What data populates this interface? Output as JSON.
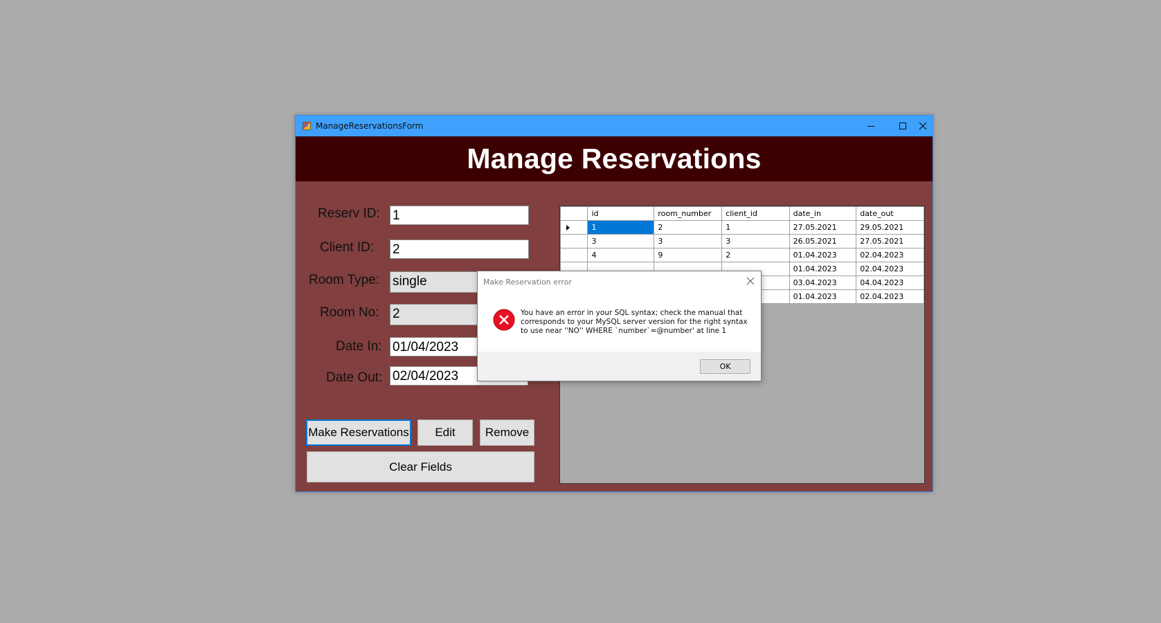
{
  "window": {
    "title": "ManageReservationsForm",
    "header_title": "Manage Reservations",
    "colors": {
      "titlebar": "#3fa1fd",
      "header": "#3d0001",
      "body": "#813f3f"
    }
  },
  "form": {
    "reserv_id_label": "Reserv ID:",
    "reserv_id_value": "1",
    "client_id_label": "Client ID:",
    "client_id_value": "2",
    "room_type_label": "Room Type:",
    "room_type_value": "single",
    "room_no_label": "Room No:",
    "room_no_value": "2",
    "date_in_label": "Date In:",
    "date_in_value": "01/04/2023",
    "date_out_label": "Date Out:",
    "date_out_value": "02/04/2023"
  },
  "buttons": {
    "make": "Make Reservations",
    "edit": "Edit",
    "remove": "Remove",
    "clear": "Clear Fields"
  },
  "grid": {
    "columns": [
      "id",
      "room_number",
      "client_id",
      "date_in",
      "date_out"
    ],
    "rows": [
      [
        "1",
        "2",
        "1",
        "27.05.2021",
        "29.05.2021"
      ],
      [
        "3",
        "3",
        "3",
        "26.05.2021",
        "27.05.2021"
      ],
      [
        "4",
        "9",
        "2",
        "01.04.2023",
        "02.04.2023"
      ],
      [
        "",
        "",
        "",
        "01.04.2023",
        "02.04.2023"
      ],
      [
        "",
        "",
        "",
        "03.04.2023",
        "04.04.2023"
      ],
      [
        "",
        "",
        "",
        "01.04.2023",
        "02.04.2023"
      ]
    ]
  },
  "dialog": {
    "title": "Make Reservation error",
    "message_lines": [
      "You have an error in your SQL syntax; check the manual that",
      "corresponds to your MySQL server version for the right syntax",
      "to use near ''NO'' WHERE `number`=@number' at line 1"
    ],
    "ok": "OK",
    "icon": "error-icon"
  }
}
